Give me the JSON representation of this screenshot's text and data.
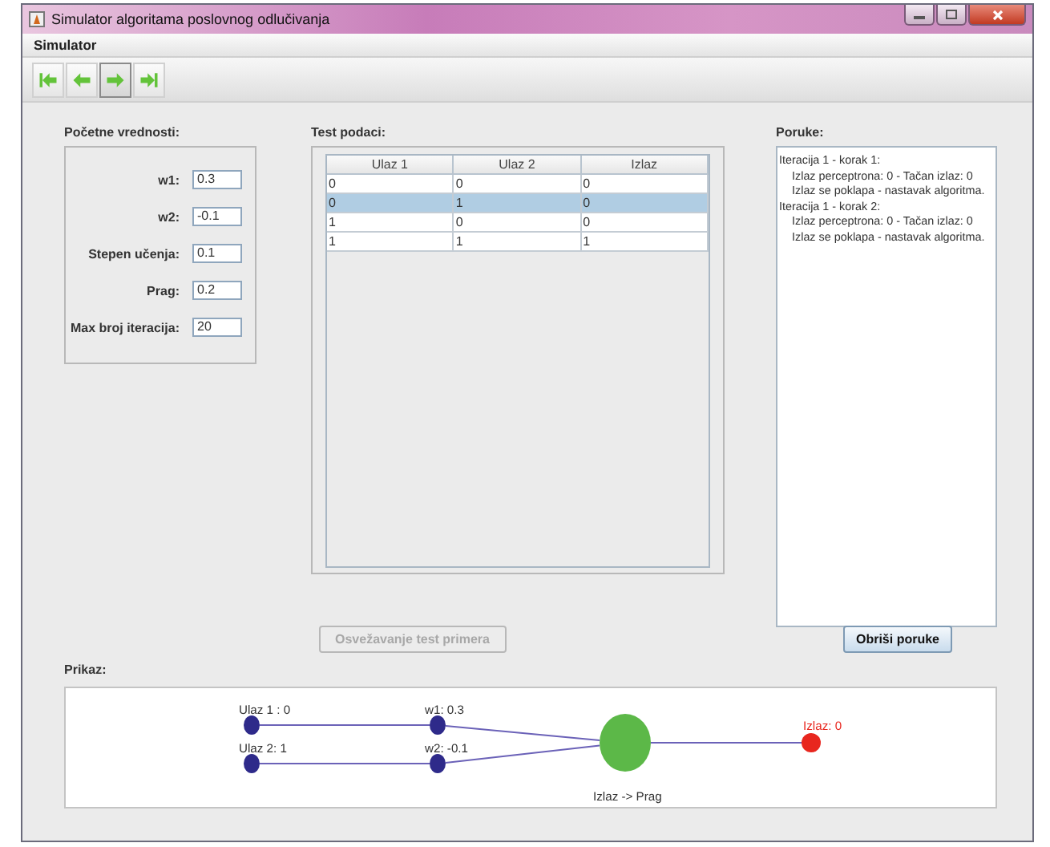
{
  "window": {
    "title": "Simulator algoritama poslovnog odlučivanja"
  },
  "menu": [
    {
      "label": "Simulator"
    }
  ],
  "toolbar": [
    {
      "kind": "first",
      "selected": false
    },
    {
      "kind": "previous",
      "selected": false
    },
    {
      "kind": "next",
      "selected": true
    },
    {
      "kind": "last",
      "selected": false
    }
  ],
  "initial_values": {
    "title": "Početne vrednosti:",
    "fields": [
      {
        "label": "w1:",
        "value": "0.3"
      },
      {
        "label": "w2:",
        "value": "-0.1"
      },
      {
        "label": "Stepen učenja:",
        "value": "0.1"
      },
      {
        "label": "Prag:",
        "value": "0.2"
      },
      {
        "label": "Max broj iteracija:",
        "value": "20"
      }
    ]
  },
  "test_data": {
    "title": "Test podaci:",
    "columns": [
      "Ulaz 1",
      "Ulaz 2",
      "Izlaz"
    ],
    "rows": [
      {
        "cells": [
          "0",
          "0",
          "0"
        ],
        "selected": false
      },
      {
        "cells": [
          "0",
          "1",
          "0"
        ],
        "selected": true
      },
      {
        "cells": [
          "1",
          "0",
          "0"
        ],
        "selected": false
      },
      {
        "cells": [
          "1",
          "1",
          "1"
        ],
        "selected": false
      }
    ],
    "refresh_button": {
      "label": "Osvežavanje test primera",
      "disabled": true
    }
  },
  "messages": {
    "title": "Poruke:",
    "items": [
      {
        "text": "Iteracija 1 - korak 1:",
        "children": [
          {
            "text": "Izlaz perceptrona: 0 - Tačan izlaz: 0"
          },
          {
            "text": "Izlaz se poklapa - nastavak algoritma."
          }
        ]
      },
      {
        "text": "Iteracija 1 - korak 2:",
        "children": [
          {
            "text": "Izlaz perceptrona: 0 - Tačan izlaz: 0"
          },
          {
            "text": "Izlaz se poklapa - nastavak algoritma."
          }
        ]
      }
    ],
    "clear_button": {
      "label": "Obriši poruke",
      "disabled": false
    }
  },
  "display": {
    "title": "Prikaz:",
    "nodes": [
      {
        "kind": "input",
        "label": "Ulaz 1 : 0"
      },
      {
        "kind": "input",
        "label": "Ulaz 2: 1"
      },
      {
        "kind": "weight",
        "label": "w1: 0.3"
      },
      {
        "kind": "weight",
        "label": "w2: -0.1"
      },
      {
        "kind": "neuron",
        "label": "Izlaz -> Prag"
      },
      {
        "kind": "output",
        "label": "Izlaz: 0"
      }
    ]
  }
}
